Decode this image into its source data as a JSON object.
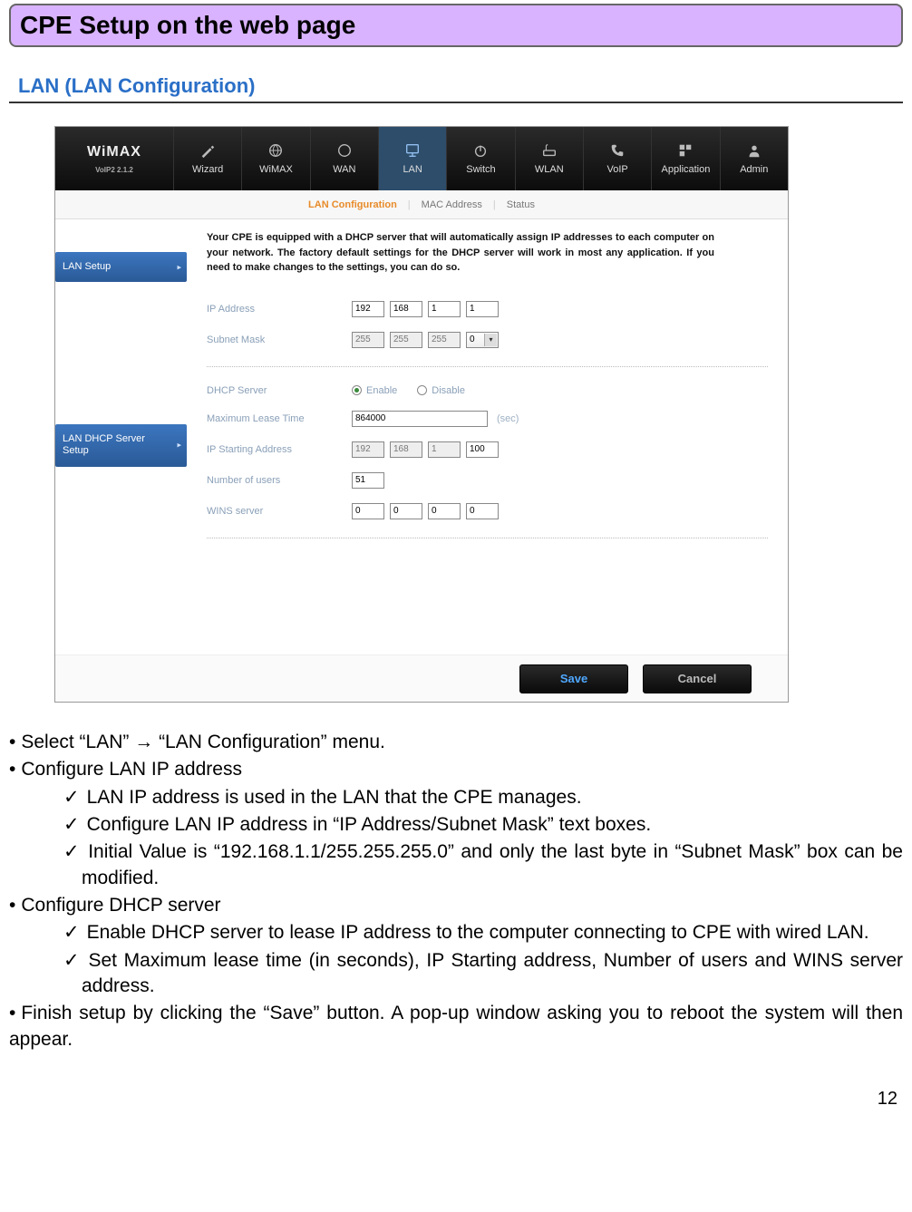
{
  "titleBar": "CPE Setup on the web page",
  "subheading": "LAN (LAN Configuration)",
  "ss": {
    "logo": {
      "main": "WiMAX",
      "sub": "VoIP2 2.1.2"
    },
    "nav": [
      "Wizard",
      "WiMAX",
      "WAN",
      "LAN",
      "Switch",
      "WLAN",
      "VoIP",
      "Application",
      "Admin"
    ],
    "navActive": "LAN",
    "subnav": {
      "items": [
        "LAN Configuration",
        "MAC Address",
        "Status"
      ],
      "active": "LAN Configuration"
    },
    "side": {
      "item1": "LAN Setup",
      "item2a": "LAN DHCP Server",
      "item2b": "Setup"
    },
    "intro": "Your CPE is equipped with a DHCP server that will automatically assign IP addresses to each computer on your network. The factory default settings for the DHCP server will work in most any application. If you need to make changes to the settings, you can do so.",
    "labels": {
      "ip": "IP Address",
      "mask": "Subnet Mask",
      "dhcp": "DHCP Server",
      "enable": "Enable",
      "disable": "Disable",
      "lease": "Maximum Lease Time",
      "sec": "(sec)",
      "start": "IP Starting Address",
      "users": "Number of users",
      "wins": "WINS server"
    },
    "values": {
      "ip": [
        "192",
        "168",
        "1",
        "1"
      ],
      "mask": [
        "255",
        "255",
        "255",
        "0"
      ],
      "lease": "864000",
      "start": [
        "192",
        "168",
        "1",
        "100"
      ],
      "users": "51",
      "wins": [
        "0",
        "0",
        "0",
        "0"
      ]
    },
    "buttons": {
      "save": "Save",
      "cancel": "Cancel"
    }
  },
  "instr": {
    "l1": "Select “LAN” → “LAN Configuration” menu.",
    "l2": "Configure LAN IP address",
    "l2a": "LAN IP address is used in the LAN that the CPE manages.",
    "l2b": "Configure LAN IP address in “IP Address/Subnet Mask” text boxes.",
    "l2c": "Initial Value is “192.168.1.1/255.255.255.0” and only the last byte in “Subnet Mask” box can be modified.",
    "l3": "Configure DHCP server",
    "l3a": "Enable DHCP server to lease IP address to the computer connecting to CPE with wired LAN.",
    "l3b": "Set Maximum lease time (in seconds), IP Starting address, Number of users and WINS server address.",
    "l4": "Finish setup by clicking the “Save” button. A pop-up window asking you to reboot the system will then appear."
  },
  "pageNumber": "12"
}
